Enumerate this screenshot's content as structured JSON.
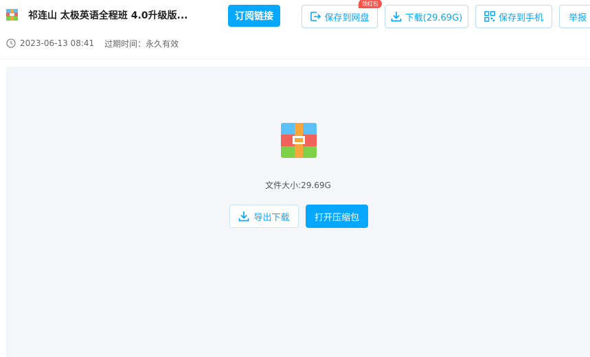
{
  "header": {
    "title": "祁连山 太极英语全程班  4.0升级版...",
    "subscribe_label": "订阅链接",
    "save_netdisk_label": "保存到网盘",
    "red_packet_badge": "领红包",
    "download_label": "下载(29.69G)",
    "save_phone_label": "保存到手机",
    "report_label": "举报"
  },
  "meta": {
    "date": "2023-06-13 08:41",
    "expire_label": "过期时间：",
    "expire_value": "永久有效"
  },
  "preview": {
    "file_icon": "zip-archive-icon",
    "size_text": "文件大小:29.69G",
    "export_download_label": "导出下载",
    "open_archive_label": "打开压缩包"
  },
  "colors": {
    "accent": "#06a7ff",
    "badge": "#f5554a",
    "panel_bg": "#f5f6fa"
  }
}
